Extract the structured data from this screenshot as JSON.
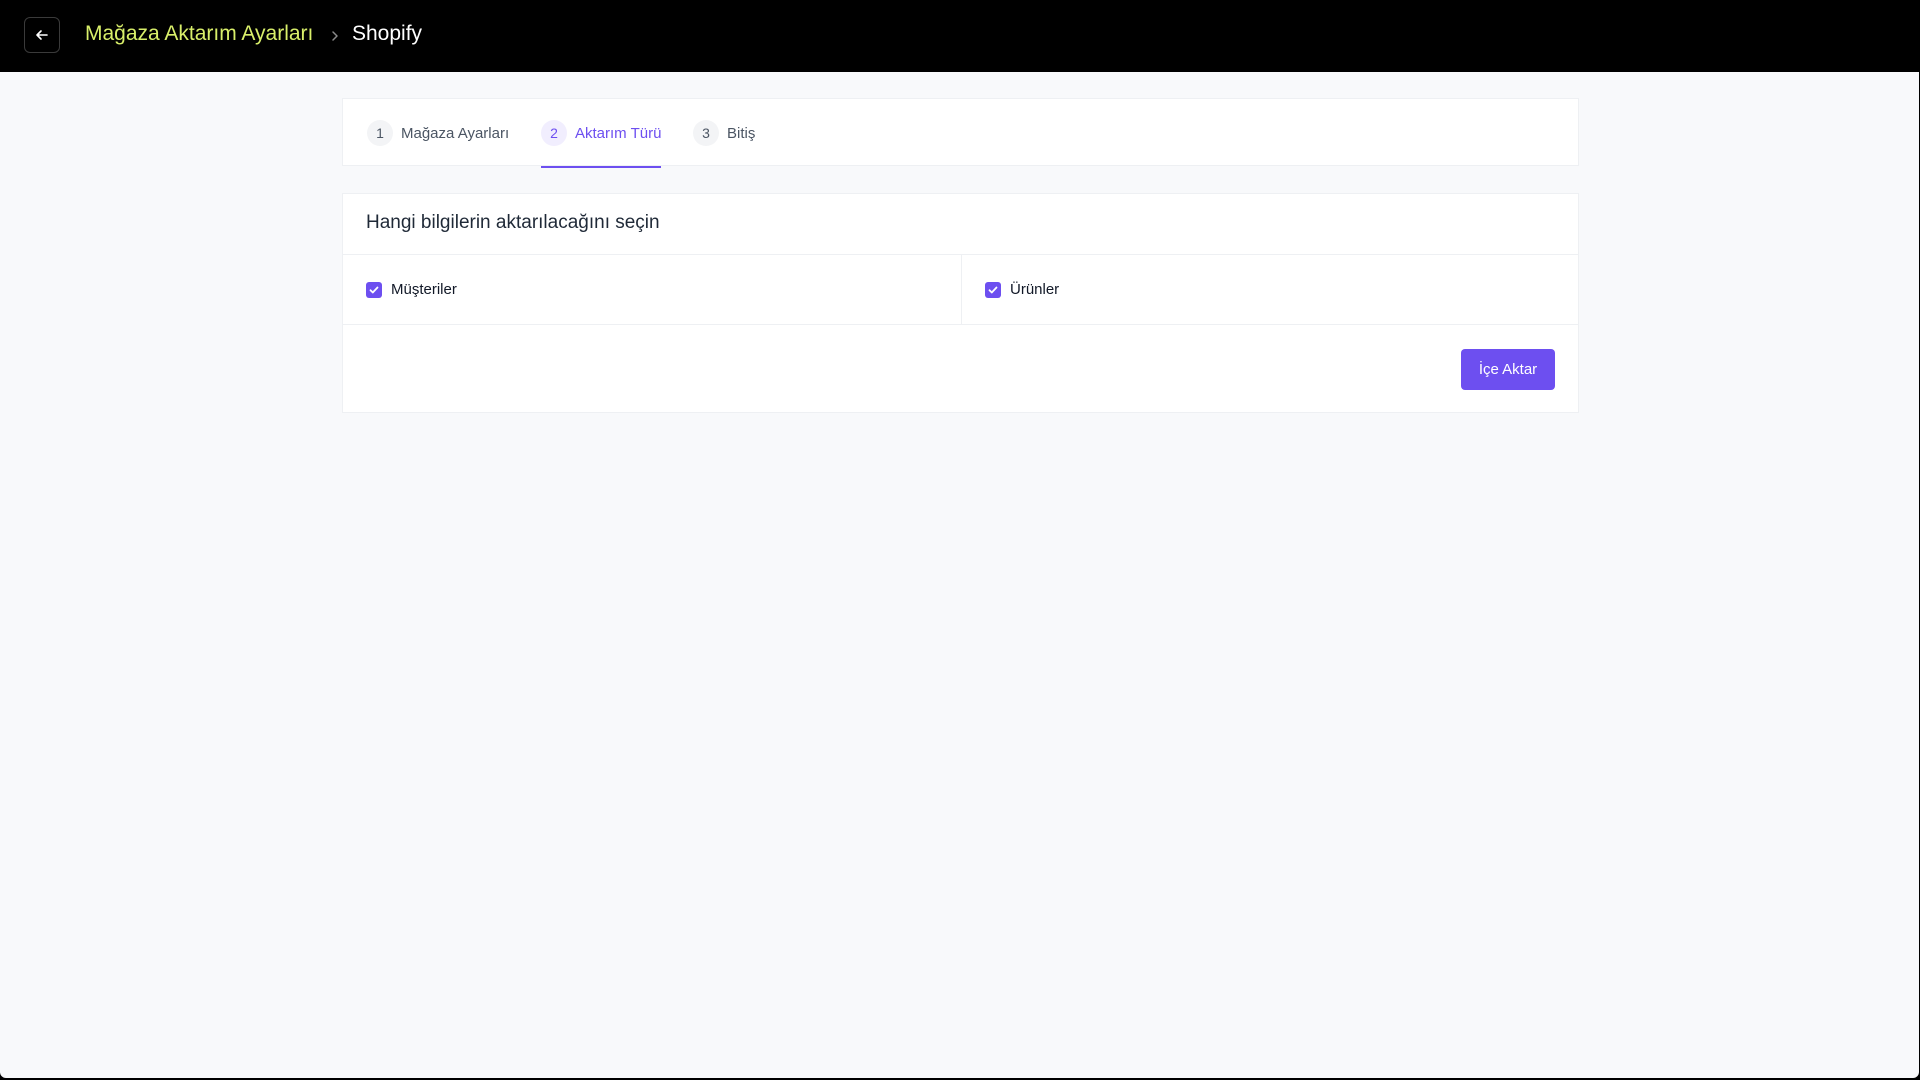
{
  "header": {
    "back_icon": "arrow-left-icon",
    "breadcrumb_parent": "Mağaza Aktarım Ayarları",
    "separator_icon": "chevron-right-icon",
    "breadcrumb_current": "Shopify"
  },
  "steps": [
    {
      "number": "1",
      "label": "Mağaza Ayarları",
      "active": false
    },
    {
      "number": "2",
      "label": "Aktarım Türü",
      "active": true
    },
    {
      "number": "3",
      "label": "Bitiş",
      "active": false
    }
  ],
  "form": {
    "title": "Hangi bilgilerin aktarılacağını seçin",
    "options": [
      {
        "label": "Müşteriler",
        "checked": true
      },
      {
        "label": "Ürünler",
        "checked": true
      }
    ],
    "submit_label": "İçe Aktar"
  },
  "colors": {
    "accent": "#6d4ff0",
    "breadcrumb": "#d9ef6a",
    "topbar": "#000000",
    "background": "#f8f9fb"
  }
}
